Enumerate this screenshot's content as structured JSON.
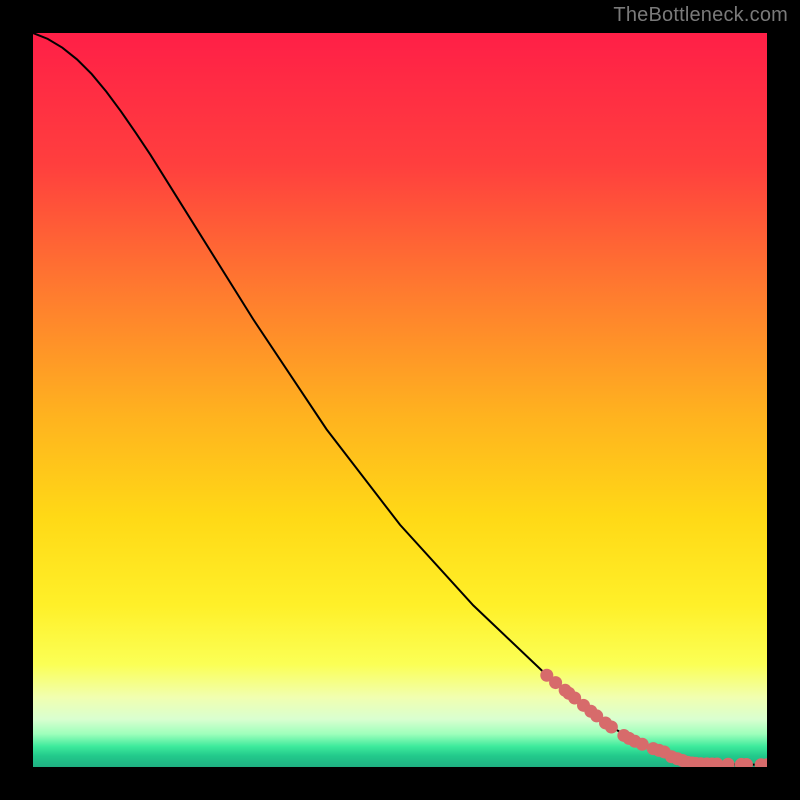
{
  "watermark": "TheBottleneck.com",
  "colors": {
    "background": "#000000",
    "curve": "#000000",
    "marker": "#d76b6b",
    "gradient_stops": [
      {
        "offset": 0.0,
        "color": "#ff1f47"
      },
      {
        "offset": 0.18,
        "color": "#ff3f3e"
      },
      {
        "offset": 0.35,
        "color": "#ff7a2f"
      },
      {
        "offset": 0.52,
        "color": "#ffb21f"
      },
      {
        "offset": 0.66,
        "color": "#ffd916"
      },
      {
        "offset": 0.78,
        "color": "#fff029"
      },
      {
        "offset": 0.86,
        "color": "#fbff55"
      },
      {
        "offset": 0.905,
        "color": "#f1ffb0"
      },
      {
        "offset": 0.935,
        "color": "#d9ffd0"
      },
      {
        "offset": 0.955,
        "color": "#9effbb"
      },
      {
        "offset": 0.972,
        "color": "#3dea9c"
      },
      {
        "offset": 0.985,
        "color": "#22c98b"
      },
      {
        "offset": 1.0,
        "color": "#1fb082"
      }
    ]
  },
  "chart_data": {
    "type": "line",
    "title": "",
    "xlabel": "",
    "ylabel": "",
    "xlim": [
      0,
      100
    ],
    "ylim": [
      0,
      100
    ],
    "series": [
      {
        "name": "bottleneck-curve",
        "x": [
          0,
          2,
          4,
          6,
          8,
          10,
          12,
          14,
          16,
          20,
          30,
          40,
          50,
          60,
          70,
          78,
          82,
          85,
          87,
          88,
          89,
          90,
          92,
          95,
          98,
          100
        ],
        "y": [
          100,
          99.2,
          98.0,
          96.4,
          94.4,
          92.0,
          89.3,
          86.4,
          83.4,
          77.0,
          61.0,
          46.0,
          33.0,
          22.0,
          12.5,
          6.0,
          3.5,
          2.2,
          1.4,
          1.0,
          0.7,
          0.5,
          0.4,
          0.35,
          0.32,
          0.3
        ]
      }
    ],
    "markers": {
      "name": "highlighted-points",
      "x": [
        70.0,
        71.2,
        72.5,
        73.0,
        73.8,
        75.0,
        76.0,
        76.8,
        78.0,
        78.8,
        80.5,
        81.2,
        82.0,
        83.0,
        84.5,
        85.3,
        86.0,
        87.0,
        87.8,
        88.5,
        89.2,
        89.8,
        90.3,
        91.0,
        91.8,
        92.5,
        93.2,
        94.7,
        96.5,
        97.2,
        99.2,
        100.0
      ],
      "y": [
        12.5,
        11.5,
        10.45,
        10.05,
        9.4,
        8.4,
        7.6,
        6.96,
        6.0,
        5.45,
        4.3,
        3.9,
        3.5,
        3.1,
        2.5,
        2.26,
        2.05,
        1.4,
        1.12,
        0.88,
        0.63,
        0.55,
        0.49,
        0.45,
        0.43,
        0.41,
        0.4,
        0.37,
        0.35,
        0.34,
        0.31,
        0.3
      ]
    }
  }
}
